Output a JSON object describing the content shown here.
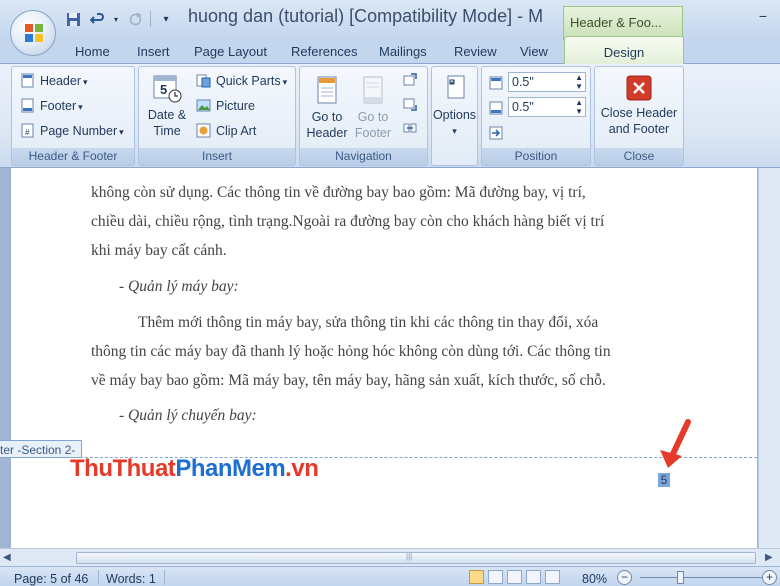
{
  "titlebar": {
    "title": "huong dan (tutorial) [Compatibility Mode] - M",
    "context_tab": "Header & Foo...",
    "minimize": "−"
  },
  "qat": {
    "save_icon": "save-icon",
    "undo_icon": "undo-icon",
    "redo_icon": "redo-icon",
    "customize_icon": "customize-icon"
  },
  "tabs": [
    "Home",
    "Insert",
    "Page Layout",
    "References",
    "Mailings",
    "Review",
    "View"
  ],
  "design_tab": "Design",
  "ribbon": {
    "header_footer": {
      "label": "Header & Footer",
      "header": "Header",
      "footer": "Footer",
      "page_number": "Page Number"
    },
    "insert": {
      "label": "Insert",
      "date_time_1": "Date &",
      "date_time_2": "Time",
      "quick_parts": "Quick Parts",
      "picture": "Picture",
      "clip_art": "Clip Art",
      "calendar_day": "5"
    },
    "navigation": {
      "label": "Navigation",
      "goto_header_1": "Go to",
      "goto_header_2": "Header",
      "goto_footer_1": "Go to",
      "goto_footer_2": "Footer"
    },
    "options": {
      "label": "Options"
    },
    "position": {
      "label": "Position",
      "header_from_top": "0.5\"",
      "footer_from_bottom": "0.5\""
    },
    "close": {
      "label": "Close",
      "button_1": "Close Header",
      "button_2": "and Footer"
    }
  },
  "document": {
    "lines": [
      "không còn sử dụng. Các thông tin về đường bay bao gồm: Mã đường bay, vị trí,",
      "chiều dài, chiều rộng, tình trạng.Ngoài ra đường bay còn cho khách hàng biết vị trí",
      "khi máy bay cất cánh.",
      "- Quản lý máy bay:",
      "Thêm mới thông tin máy bay, sửa thông tin khi các thông tin thay đổi, xóa",
      "thông tin các máy bay đã thanh lý hoặc hỏng hóc không còn dùng tới. Các thông tin",
      "về máy bay bao gồm: Mã máy bay, tên máy bay, hãng sản xuất, kích thước, số chỗ.",
      "- Quản lý chuyến bay:"
    ],
    "footer_tag": "ter -Section 2-",
    "page_number": "5",
    "watermark_a": "ThuThuat",
    "watermark_b": "PhanMem",
    "watermark_c": ".vn"
  },
  "statusbar": {
    "page": "Page: 5 of 46",
    "words": "Words: 1",
    "zoom": "80%",
    "zoom_out": "−",
    "zoom_in": "+"
  }
}
